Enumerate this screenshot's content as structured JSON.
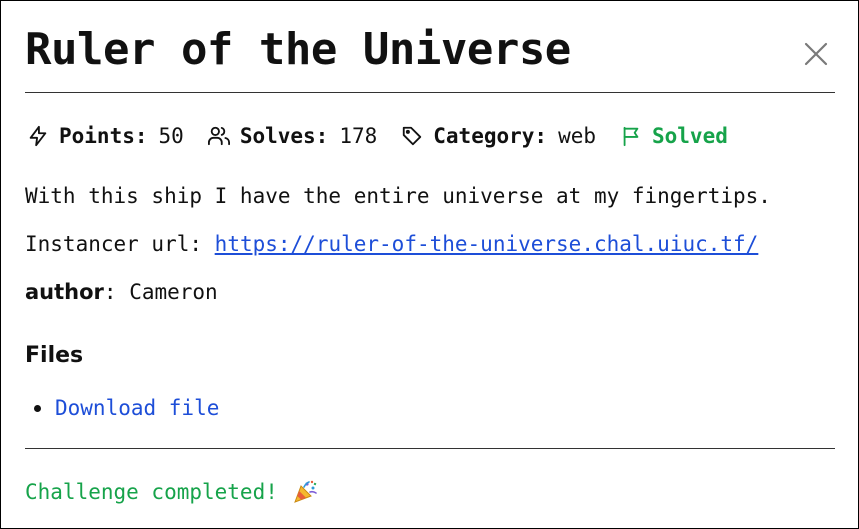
{
  "modal": {
    "title": "Ruler of the Universe",
    "close_icon": "close-x-icon"
  },
  "meta": {
    "points_icon": "lightning-icon",
    "points_label": "Points:",
    "points_value": "50",
    "solves_icon": "users-icon",
    "solves_label": "Solves:",
    "solves_value": "178",
    "category_icon": "tag-icon",
    "category_label": "Category:",
    "category_value": "web",
    "status_icon": "flag-icon",
    "status_label": "Solved"
  },
  "description": {
    "line1": "With this ship I have the entire universe at my fingertips.",
    "instancer_label": "Instancer url:",
    "instancer_url": "https://ruler-of-the-universe.chal.uiuc.tf/",
    "author_label": "author",
    "author_value": ": Cameron"
  },
  "files": {
    "heading": "Files",
    "items": [
      {
        "label": "Download file"
      }
    ]
  },
  "footer": {
    "completed_text": "Challenge completed!",
    "completed_icon": "party-popper-icon"
  },
  "colors": {
    "success": "#16a34a",
    "link": "#1d4ed8",
    "text": "#111111"
  }
}
